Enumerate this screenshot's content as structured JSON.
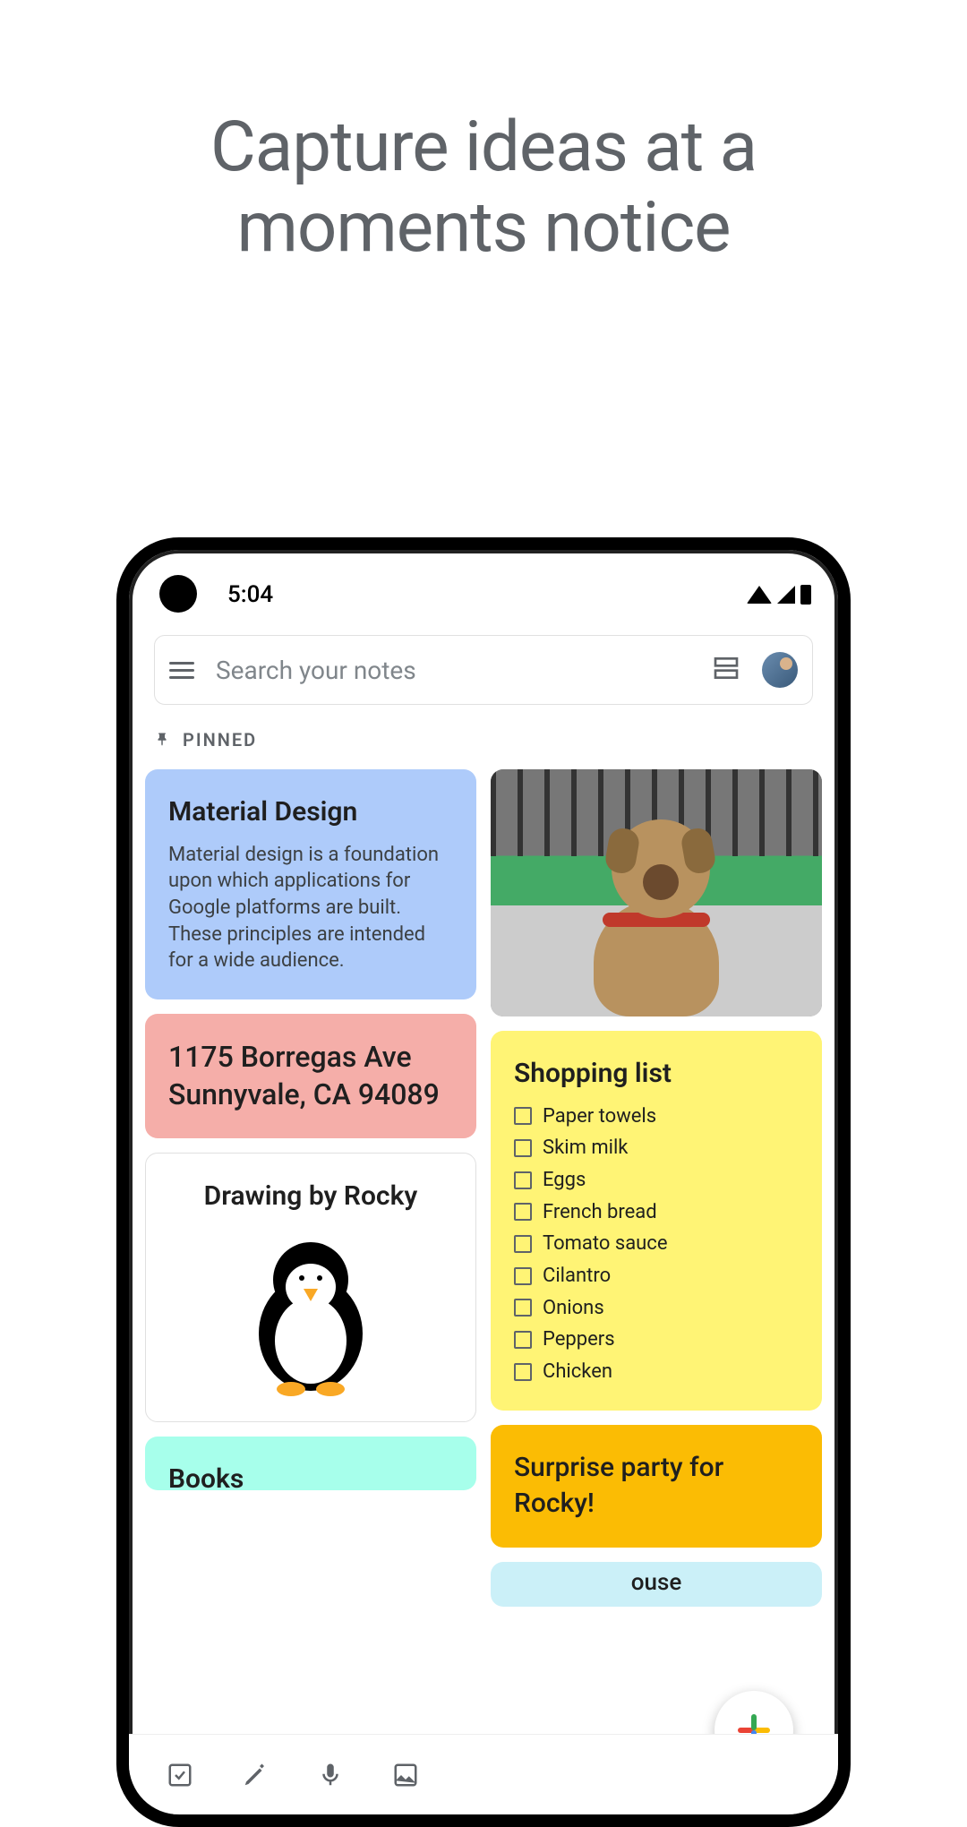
{
  "promo": {
    "headline_line1": "Capture ideas at a",
    "headline_line2": "moments notice"
  },
  "status_bar": {
    "time": "5:04"
  },
  "search": {
    "placeholder": "Search your notes"
  },
  "section": {
    "pinned_label": "PINNED"
  },
  "notes": {
    "material": {
      "title": "Material Design",
      "body": "Material design is a foundation upon which applications for Google platforms are built. These principles are intended for a wide audience."
    },
    "address": {
      "title": "1175 Borregas Ave Sunnyvale, CA 94089"
    },
    "drawing": {
      "title": "Drawing by Rocky"
    },
    "books": {
      "title": "Books"
    },
    "shopping": {
      "title": "Shopping list",
      "items": [
        "Paper towels",
        "Skim milk",
        "Eggs",
        "French bread",
        "Tomato sauce",
        "Cilantro",
        "Onions",
        "Peppers",
        "Chicken"
      ]
    },
    "party": {
      "title": "Surprise party for Rocky!"
    },
    "house": {
      "partial": "ouse"
    }
  },
  "colors": {
    "blue": "#aecbfa",
    "pink": "#f5aea9",
    "yellow": "#fff475",
    "orange": "#fbbc04",
    "teal": "#a7ffeb",
    "lightblue": "#cbf0f8"
  }
}
